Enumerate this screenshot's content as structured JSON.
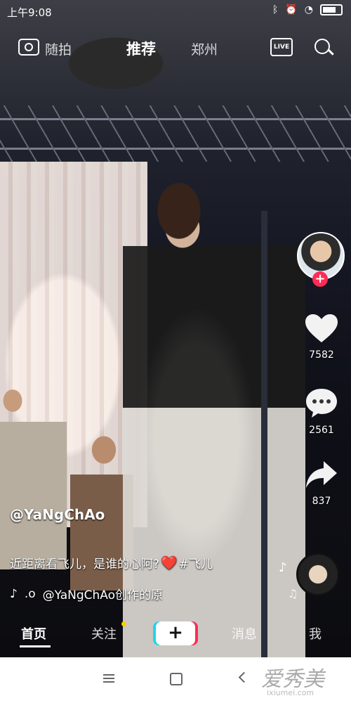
{
  "status_bar": {
    "time": "上午9:08",
    "icons": [
      "bluetooth-icon",
      "alarm-icon",
      "wifi-icon",
      "battery-icon"
    ]
  },
  "top_nav": {
    "camera_label": "随拍",
    "recommend_label": "推荐",
    "city_label": "郑州",
    "live_label": "LIVE"
  },
  "video": {
    "author": "@YaNgChAo",
    "description_text": "近距离看飞儿，是谁的心阿?",
    "description_emoji": "❤️",
    "hashtag": "#飞儿",
    "music_prefix": ".o",
    "music_text": "@YaNgChAo创作的原"
  },
  "actions": {
    "likes": "7582",
    "comments": "2561",
    "shares": "837"
  },
  "tab_bar": {
    "home": "首页",
    "follow": "关注",
    "create": "+",
    "messages": "消息",
    "me": "我"
  },
  "watermark": {
    "text": "爱秀美",
    "sub": "ixiumei.com"
  },
  "colors": {
    "accent_red": "#fe2c55",
    "accent_cyan": "#20d5ec",
    "notification_dot": "#ffcc00"
  }
}
